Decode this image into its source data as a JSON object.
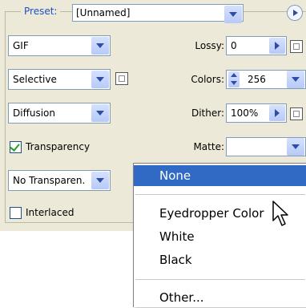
{
  "preset": {
    "label": "Preset:",
    "value": "[Unnamed]"
  },
  "left_column": {
    "format": "GIF",
    "reduction": "Selective",
    "dither_algorithm": "Diffusion",
    "transparency_label": "Transparency",
    "transparency_checked": true,
    "transparency_dither": "No Transparen.",
    "interlaced_label": "Interlaced",
    "interlaced_checked": false
  },
  "right_column": {
    "lossy_label": "Lossy:",
    "lossy_value": "0",
    "colors_label": "Colors:",
    "colors_value": "256",
    "dither_label": "Dither:",
    "dither_value": "100%",
    "matte_label": "Matte:",
    "matte_value": ""
  },
  "matte_menu": {
    "items": [
      "None",
      "Eyedropper Color",
      "White",
      "Black",
      "Other..."
    ],
    "selected": "None"
  }
}
